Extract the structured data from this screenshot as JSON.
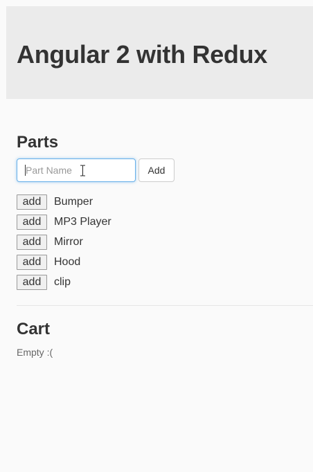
{
  "header": {
    "title": "Angular 2 with Redux"
  },
  "parts": {
    "title": "Parts",
    "input": {
      "placeholder": "Part Name",
      "value": ""
    },
    "add_label": "Add",
    "items": [
      {
        "button": "add",
        "name": "Bumper"
      },
      {
        "button": "add",
        "name": "MP3 Player"
      },
      {
        "button": "add",
        "name": "Mirror"
      },
      {
        "button": "add",
        "name": "Hood"
      },
      {
        "button": "add",
        "name": "clip"
      }
    ]
  },
  "cart": {
    "title": "Cart",
    "empty_text": "Empty :("
  },
  "colors": {
    "header_bg": "#ebebeb",
    "input_focus_border": "#66afe9",
    "page_bg": "#fafafa"
  }
}
